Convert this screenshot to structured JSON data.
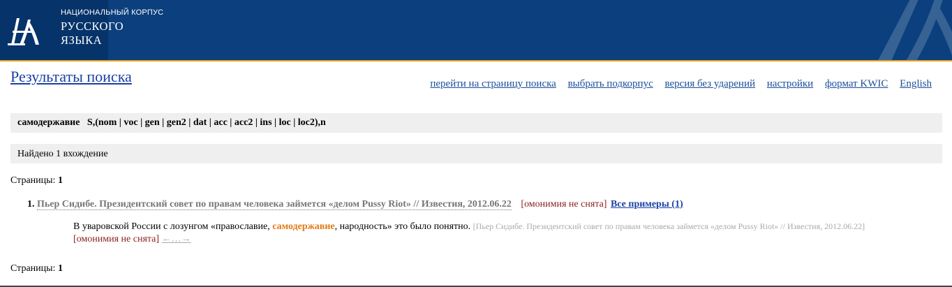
{
  "header": {
    "line1": "НАЦИОНАЛЬНЫЙ КОРПУС",
    "line2": "РУССКОГО",
    "line3": "ЯЗЫКА",
    "logo_icon": "corpus-logo-icon",
    "colors": {
      "background": "#0b3f7d",
      "accent": "#e4a11b"
    }
  },
  "page_title": "Результаты поиска",
  "nav": [
    "перейти на страницу поиска",
    "выбрать подкорпус",
    "версия без ударений",
    "настройки",
    "формат KWIC",
    "English"
  ],
  "query": {
    "text": "самодержавие   S,(nom | voc | gen | gen2 | dat | acc | acc2 | ins | loc | loc2),n"
  },
  "found": "Найдено 1 вхождение",
  "pages": {
    "label": "Страницы:",
    "current": "1"
  },
  "result": {
    "number": "1.",
    "source": "Пьер Сидибе. Президентский совет по правам человека займется «делом Pussy Riot» // Известия, 2012.06.22",
    "homonymy": "[омонимия не снята]",
    "all_examples": "Все примеры (1)",
    "snippet": {
      "before": "В уваровской России с лозунгом «православие, ",
      "highlight": "самодержавие",
      "after": ", народность» это было понятно. ",
      "source": "[Пьер Сидибе. Президентский совет по правам человека займется «делом Pussy Riot» // Известия, 2012.06.22]",
      "homonymy": "[омонимия не снята]",
      "context_link": "←…→"
    }
  }
}
